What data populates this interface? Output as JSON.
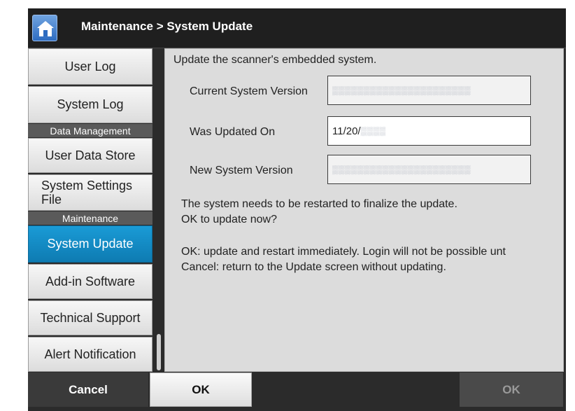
{
  "header": {
    "title": "Maintenance > System Update",
    "home_icon": "home-icon"
  },
  "sidebar": {
    "items": [
      {
        "label": "User Log"
      },
      {
        "label": "System Log"
      },
      {
        "section": "Data Management"
      },
      {
        "label": "User Data Store"
      },
      {
        "label": "System Settings File"
      },
      {
        "section": "Maintenance"
      },
      {
        "label": "System Update",
        "active": true
      },
      {
        "label": "Add-in Software"
      },
      {
        "label": "Technical Support"
      },
      {
        "label": "Alert Notification"
      }
    ]
  },
  "main": {
    "intro": "Update the scanner's embedded system.",
    "fields": [
      {
        "label": "Current System Version",
        "value": ""
      },
      {
        "label": "Was Updated On",
        "value": "11/20/"
      },
      {
        "label": "New System Version",
        "value": ""
      }
    ],
    "message_line1": "The system needs to be restarted to finalize the update.",
    "message_line2": "OK to update now?",
    "note_line1": "OK: update and restart immediately. Login will not be possible unt",
    "note_line2": "Cancel: return to the Update screen without updating."
  },
  "footer": {
    "cancel_label": "Cancel",
    "ok_label": "OK",
    "ok_disabled_label": "OK"
  },
  "colors": {
    "accent": "#0e87c4",
    "header_bg": "#1f1f1f",
    "panel_bg": "#dcdcdc"
  }
}
